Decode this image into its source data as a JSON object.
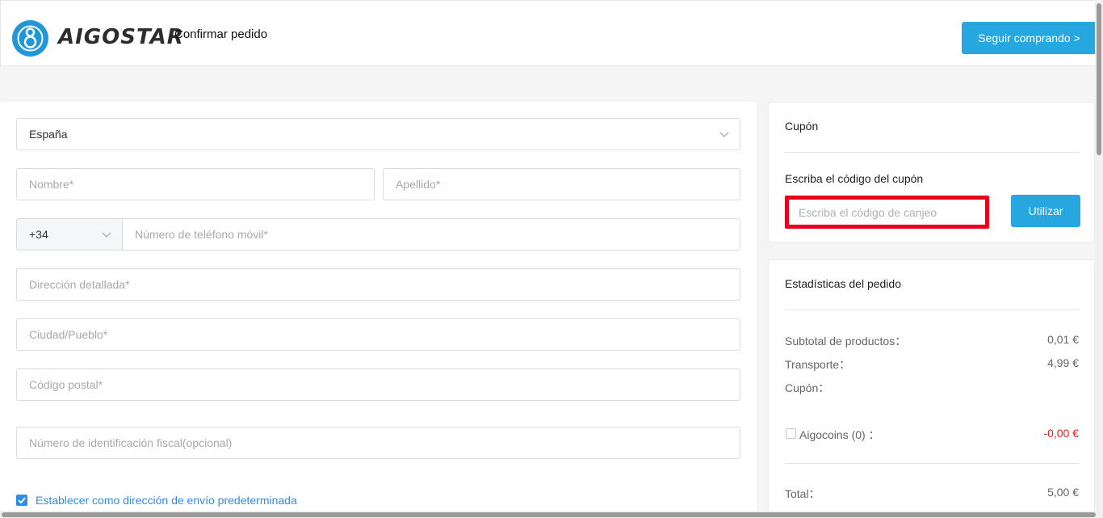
{
  "header": {
    "brand": "AIGOSTAR",
    "page_title": "Confirmar pedido",
    "continue_label": "Seguir comprando >"
  },
  "form": {
    "country": "España",
    "first_name_placeholder": "Nombre*",
    "last_name_placeholder": "Apellido*",
    "phone_code": "+34",
    "phone_placeholder": "Número de teléfono móvil*",
    "address_placeholder": "Dirección detallada*",
    "city_placeholder": "Ciudad/Pueblo*",
    "postal_placeholder": "Código postal*",
    "tax_id_placeholder": "Número de identificación fiscal(opcional)",
    "default_address_label": "Establecer como dirección de envío predeterminada",
    "default_address_checked": true
  },
  "coupon": {
    "title": "Cupón",
    "subtitle": "Escriba el código del cupón",
    "input_placeholder": "Escriba el código de canjeo",
    "use_label": "Utilizar"
  },
  "stats": {
    "title": "Estadísticas del pedido",
    "subtotal_label": "Subtotal de productos：",
    "subtotal_value": "0,01 €",
    "shipping_label": "Transporte：",
    "shipping_value": "4,99 €",
    "coupon_label": "Cupón：",
    "coins_label": "Aigocoins (0) ：",
    "coins_value": "-0,00 €",
    "total_label": "Total：",
    "total_value": "5,00 €"
  },
  "colors": {
    "accent": "#27a7df",
    "link": "#2d8ee6",
    "highlight": "#e8001c",
    "negative": "#e02020"
  }
}
